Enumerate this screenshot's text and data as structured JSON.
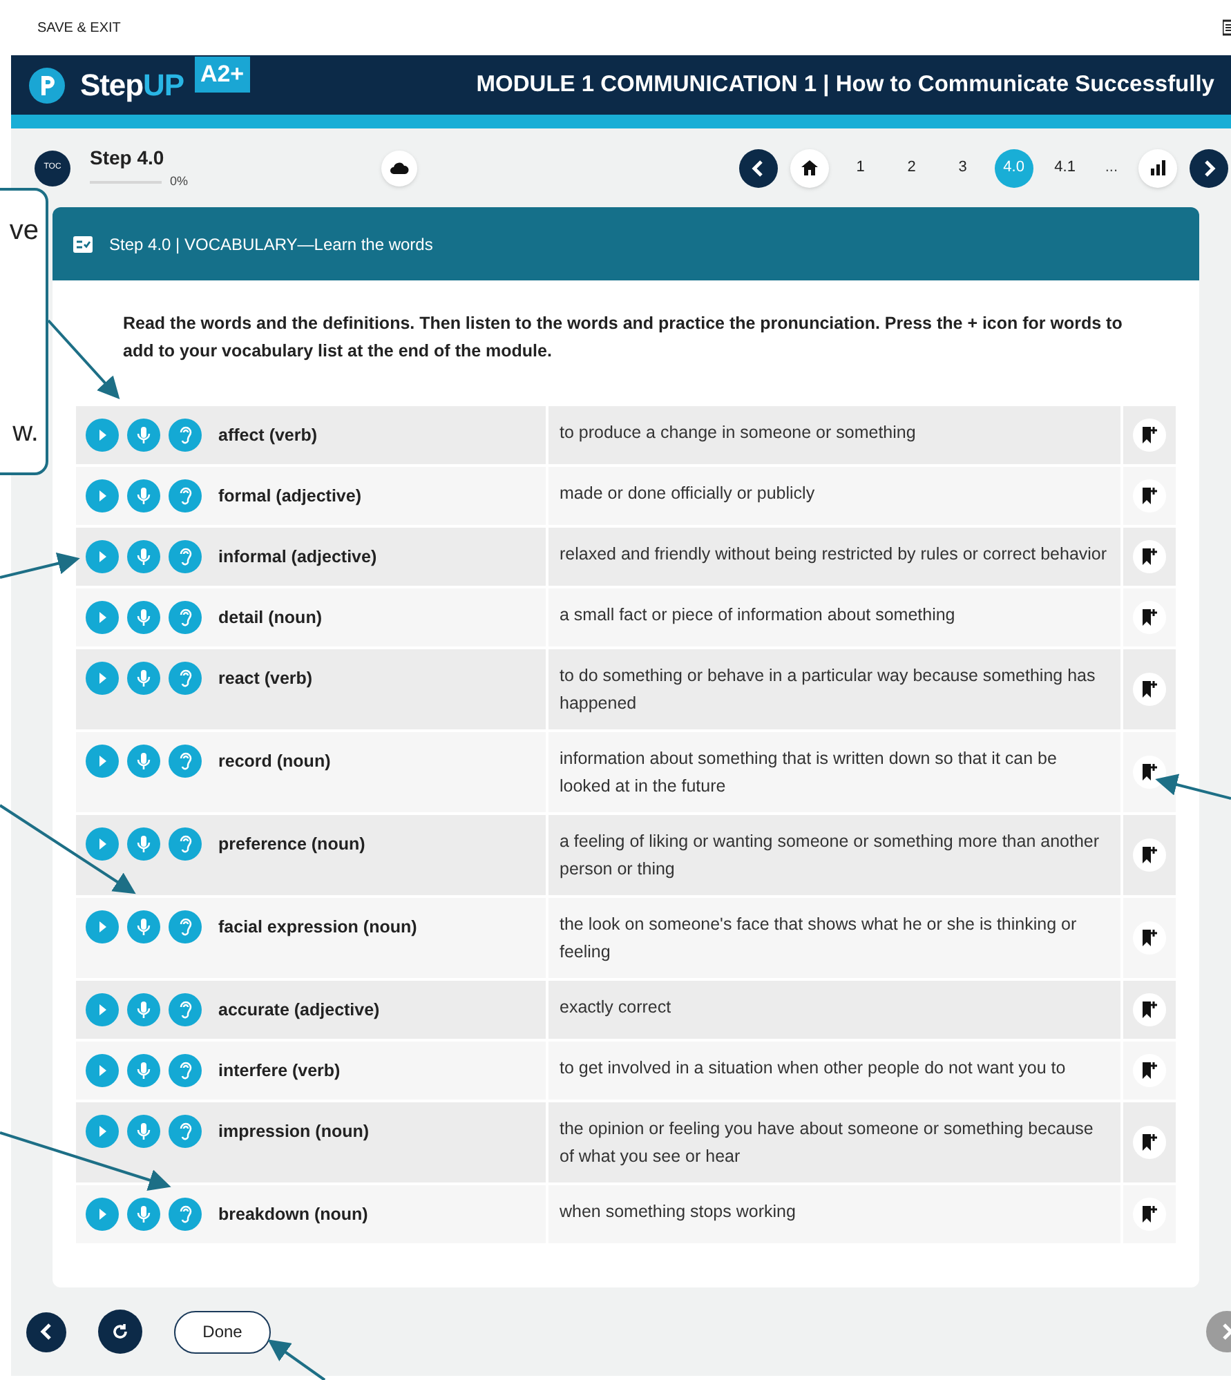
{
  "top_bar": {
    "save_exit": "SAVE & EXIT"
  },
  "header": {
    "brand": "Step",
    "brand_accent": "UP",
    "level": "A2+",
    "title": "MODULE 1 COMMUNICATION 1 | How to Communicate Successfully"
  },
  "step": {
    "toc": "TOC",
    "label": "Step 4.0",
    "level": 0,
    "progress": "0%"
  },
  "pager": [
    {
      "label": "1",
      "selected": false
    },
    {
      "label": "2",
      "selected": false
    },
    {
      "label": "3",
      "selected": false
    },
    {
      "label": "4.0",
      "selected": true
    },
    {
      "label": "4.1",
      "selected": false
    }
  ],
  "pager_more": "...",
  "card": {
    "title": "Step 4.0 | VOCABULARY—Learn the words",
    "instructions": "Read the words and the definitions. Then listen to the words and practice the pronunciation. Press the + icon for words to add to your vocabulary list at the end of the module."
  },
  "words": [
    {
      "word": "affect (verb)",
      "definition": "to produce a change in someone or something"
    },
    {
      "word": "formal (adjective)",
      "definition": "made or done officially or publicly"
    },
    {
      "word": "informal (adjective)",
      "definition": "relaxed and friendly without being restricted by rules or correct behavior"
    },
    {
      "word": "detail (noun)",
      "definition": "a small fact or piece of information about something"
    },
    {
      "word": "react (verb)",
      "definition": "to do something or behave in a particular way because something has happened"
    },
    {
      "word": "record (noun)",
      "definition": "information about something that is written down so that it can be looked at in the future"
    },
    {
      "word": "preference (noun)",
      "definition": "a feeling of liking or wanting someone or something more than another person or thing"
    },
    {
      "word": "facial expression (noun)",
      "definition": "the look on someone's face that shows what he or she is thinking or feeling"
    },
    {
      "word": "accurate (adjective)",
      "definition": "exactly correct"
    },
    {
      "word": "interfere (verb)",
      "definition": "to get involved in a situation when other people do not want you to"
    },
    {
      "word": "impression (noun)",
      "definition": "the opinion or feeling you have about someone or something because of what you see or hear"
    },
    {
      "word": "breakdown (noun)",
      "definition": "when something stops working"
    }
  ],
  "footer": {
    "done": "Done"
  },
  "callout": {
    "top_text": "ve",
    "bottom_text": "w."
  }
}
